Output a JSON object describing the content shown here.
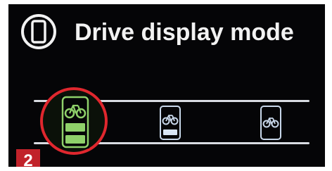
{
  "header": {
    "title": "Drive display mode",
    "icon": "phone-cycle-icon"
  },
  "modes": [
    {
      "icon": "bike-icon",
      "selected": true,
      "level": "two-bars",
      "color": "#8fd16a"
    },
    {
      "icon": "bike-icon",
      "selected": false,
      "level": "one-bar",
      "color": "#c8d7ea"
    },
    {
      "icon": "bike-icon",
      "selected": false,
      "level": "none",
      "color": "#c8d7ea"
    }
  ],
  "badge": {
    "number": "2",
    "color": "#c1222a"
  },
  "colors": {
    "screen_bg": "#050507",
    "accent_selected": "#8fd16a",
    "ring": "#e0272e"
  }
}
